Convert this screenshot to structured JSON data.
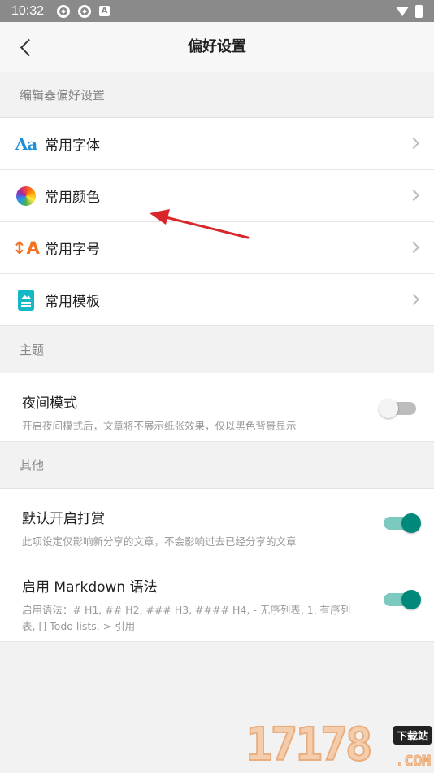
{
  "status_bar": {
    "time": "10:32",
    "icons": [
      "gear-icon",
      "gear-icon",
      "a-icon"
    ],
    "right_icons": [
      "wifi-icon",
      "battery-icon"
    ]
  },
  "header": {
    "title": "偏好设置",
    "back_icon": "chevron-left-icon"
  },
  "sections": {
    "editor": {
      "title": "编辑器偏好设置",
      "items": [
        {
          "label": "常用字体",
          "icon": "font-icon",
          "icon_text": "Aa"
        },
        {
          "label": "常用颜色",
          "icon": "color-wheel-icon"
        },
        {
          "label": "常用字号",
          "icon": "font-size-icon",
          "icon_text": "↕A"
        },
        {
          "label": "常用模板",
          "icon": "template-icon"
        }
      ]
    },
    "theme": {
      "title": "主题",
      "night_mode": {
        "title": "夜间模式",
        "desc": "开启夜间模式后，文章将不展示纸张效果，仅以黑色背景显示",
        "enabled": false
      }
    },
    "other": {
      "title": "其他",
      "reward": {
        "title": "默认开启打赏",
        "desc": "此项设定仅影响新分享的文章，不会影响过去已经分享的文章",
        "enabled": true
      },
      "markdown": {
        "title": "启用 Markdown 语法",
        "desc": "启用语法：# H1, ## H2, ### H3, #### H4, - 无序列表, 1. 有序列表, [] Todo lists, > 引用",
        "enabled": true
      }
    }
  },
  "watermark": {
    "numbers": "17178",
    "tag": "下载站",
    "suffix": ".COM"
  },
  "colors": {
    "accent": "#00897b",
    "track_on": "#7cc9c0",
    "annotation_arrow": "#d9262b"
  }
}
